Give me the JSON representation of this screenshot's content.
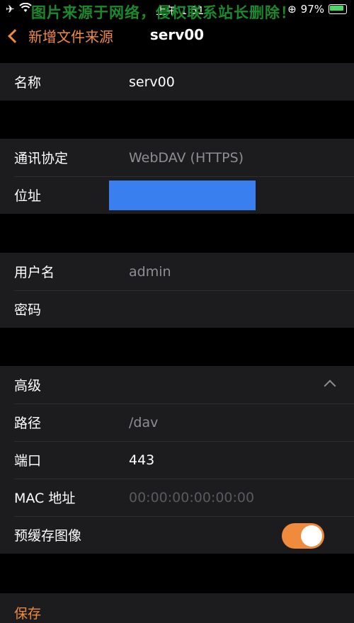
{
  "status_bar": {
    "time": "上午 1:51",
    "battery": "97%"
  },
  "watermark": "图片来源于网络，侵权联系站长删除！",
  "nav": {
    "back_label": "新增文件来源",
    "title": "serv00"
  },
  "name_section": {
    "label": "名称",
    "value": "serv00"
  },
  "connection": {
    "protocol_label": "通讯协定",
    "protocol_value": "WebDAV (HTTPS)",
    "address_label": "位址"
  },
  "credentials": {
    "username_label": "用户名",
    "username_value": "admin",
    "password_label": "密码"
  },
  "advanced": {
    "header_label": "高级",
    "path_label": "路径",
    "path_value": "/dav",
    "port_label": "端口",
    "port_value": "443",
    "mac_label": "MAC 地址",
    "mac_placeholder": "00:00:00:00:00:00",
    "cache_label": "预缓存图像",
    "cache_enabled": true
  },
  "save_label": "保存",
  "colors": {
    "accent": "#f08a3c",
    "address_redaction": "#3a7ff0",
    "group_bg": "#1c1c1e"
  }
}
